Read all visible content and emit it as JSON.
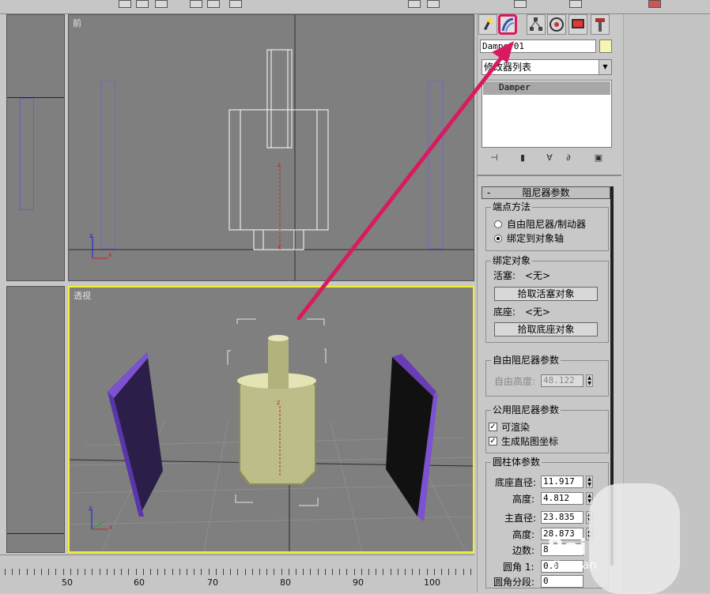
{
  "viewports": {
    "front_label": "前",
    "persp_label": "透视"
  },
  "ruler": {
    "labels": [
      "50",
      "60",
      "70",
      "80",
      "90",
      "100"
    ]
  },
  "panel": {
    "object_name": "Damper01",
    "object_color": "#f6f6b4",
    "modifier_list": "修改器列表",
    "stack_item": "Damper",
    "rollout_title": "阻尼器参数",
    "endpoint_group": {
      "title": "端点方法",
      "option1": "自由阻尼器/制动器",
      "option2": "绑定到对象轴",
      "selected": 2
    },
    "binding_group": {
      "title": "绑定对象",
      "piston_label": "活塞:",
      "piston_value": "<无>",
      "pick_piston": "拾取活塞对象",
      "base_label": "底座:",
      "base_value": "<无>",
      "pick_base": "拾取底座对象"
    },
    "free_group": {
      "title": "自由阻尼器参数",
      "height_label": "自由高度:",
      "height_value": "48.122"
    },
    "common_group": {
      "title": "公用阻尼器参数",
      "renderable": "可渲染",
      "gen_mapping": "生成贴图坐标"
    },
    "cylinder_group": {
      "title": "圆柱体参数",
      "base_diam_label": "底座直径:",
      "base_diam_value": "11.917",
      "height1_label": "高度:",
      "height1_value": "4.812",
      "main_diam_label": "主直径:",
      "main_diam_value": "23.835",
      "height2_label": "高度:",
      "height2_value": "28.873",
      "sides_label": "边数:",
      "sides_value": "8",
      "fillet1_label": "圆角 1:",
      "fillet1_value": "0.0",
      "fillet_seg_label": "圆角分段:",
      "fillet_seg_value": "0"
    }
  },
  "colors": {
    "highlight": "#d81b60",
    "viewport_active_border": "#f2ee2a",
    "purple": "#6a3db5"
  },
  "watermark": {
    "brand": "Bai",
    "sub": "jingyan"
  }
}
